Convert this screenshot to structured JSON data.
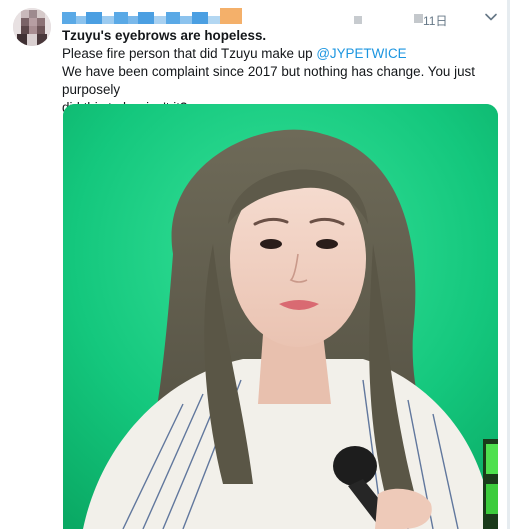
{
  "tweet": {
    "headline": "Tzuyu's eyebrows are hopeless.",
    "line1_prefix": "Please fire person that did Tzuyu make up ",
    "mention": "@JYPETWICE",
    "line2": "We have been complaint since 2017 but nothing has change. You just purposely",
    "line3": "did this to her isn't it?",
    "time_suffix": "11日"
  },
  "icons": {
    "caret": "chevron-down-icon",
    "avatar": "user-avatar"
  },
  "colors": {
    "mention": "#1b95e0",
    "photo_background": "#11c07a",
    "redaction_blue": "#5aa9e6",
    "redaction_orange": "#f4b06a"
  }
}
